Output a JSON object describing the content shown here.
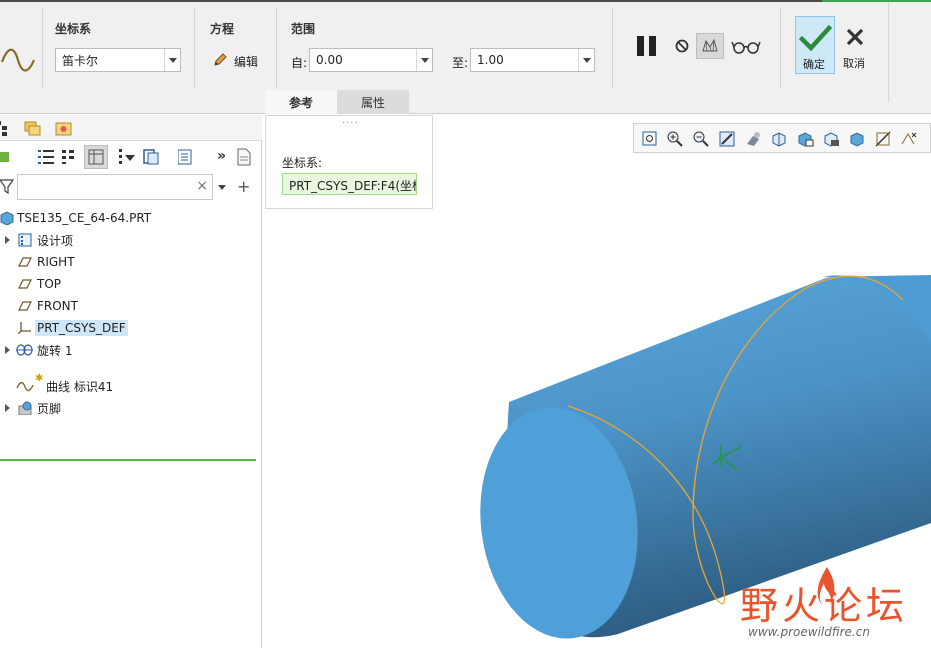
{
  "ribbon": {
    "coord_group_title": "坐标系",
    "coord_value": "笛卡尔",
    "equation_group_title": "方程",
    "edit_label": "编辑",
    "range_group_title": "范围",
    "from_label": "自:",
    "from_value": "0.00",
    "to_label": "至:",
    "to_value": "1.00",
    "ok_label": "确定",
    "cancel_label": "取消",
    "tabs": [
      {
        "label": "参考",
        "active": true
      },
      {
        "label": "属性",
        "active": false
      }
    ]
  },
  "popup": {
    "coord_label": "坐标系:",
    "coord_value": "PRT_CSYS_DEF:F4(坐标"
  },
  "tree": {
    "root": "TSE135_CE_64-64.PRT",
    "items": [
      {
        "label": "设计项",
        "expandable": true,
        "icon": "design-items-icon"
      },
      {
        "label": "RIGHT",
        "expandable": false,
        "icon": "datum-plane-icon"
      },
      {
        "label": "TOP",
        "expandable": false,
        "icon": "datum-plane-icon"
      },
      {
        "label": "FRONT",
        "expandable": false,
        "icon": "datum-plane-icon"
      },
      {
        "label": "PRT_CSYS_DEF",
        "expandable": false,
        "icon": "csys-icon",
        "selected": true
      },
      {
        "label": "旋转 1",
        "expandable": true,
        "icon": "revolve-icon"
      },
      {
        "label": "曲线 标识41",
        "expandable": false,
        "icon": "curve-icon",
        "prefix": "✱"
      },
      {
        "label": "页脚",
        "expandable": true,
        "icon": "footer-icon"
      }
    ]
  },
  "watermark": {
    "title": "野火论坛",
    "url": "www.proewildfire.cn"
  },
  "colors": {
    "cylinder": "#4e9bd4",
    "curve": "#e8a532",
    "selection": "#cfe6f9",
    "accent_green": "#3fa34d"
  }
}
